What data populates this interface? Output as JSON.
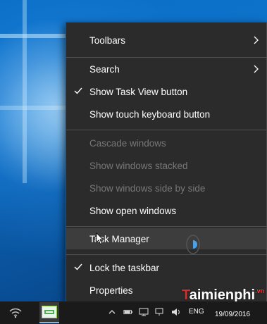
{
  "menu": {
    "items": [
      {
        "label": "Toolbars",
        "checked": false,
        "disabled": false,
        "submenu": true
      },
      {
        "label": "Search",
        "checked": false,
        "disabled": false,
        "submenu": true
      },
      {
        "label": "Show Task View button",
        "checked": true,
        "disabled": false,
        "submenu": false
      },
      {
        "label": "Show touch keyboard button",
        "checked": false,
        "disabled": false,
        "submenu": false
      },
      {
        "label": "Cascade windows",
        "checked": false,
        "disabled": true,
        "submenu": false
      },
      {
        "label": "Show windows stacked",
        "checked": false,
        "disabled": true,
        "submenu": false
      },
      {
        "label": "Show windows side by side",
        "checked": false,
        "disabled": true,
        "submenu": false
      },
      {
        "label": "Show open windows",
        "checked": false,
        "disabled": false,
        "submenu": false
      },
      {
        "label": "Task Manager",
        "checked": false,
        "disabled": false,
        "submenu": false,
        "hovered": true
      },
      {
        "label": "Lock the taskbar",
        "checked": true,
        "disabled": false,
        "submenu": false
      },
      {
        "label": "Properties",
        "checked": false,
        "disabled": false,
        "submenu": false
      }
    ]
  },
  "taskbar": {
    "language": "ENG",
    "date": "19/09/2016",
    "tray_icons": [
      "chevron-up-icon",
      "battery-icon",
      "network-icon",
      "monitor-icon",
      "volume-icon"
    ],
    "pinned_app": "thumbnail-app-icon"
  },
  "watermark": {
    "prefix": "T",
    "brand": "aimienphi",
    "suffix": ".vn"
  },
  "colors": {
    "menu_bg": "#2b2b2b",
    "menu_hover": "#3d3d3d",
    "text": "#ffffff",
    "disabled_text": "#777777",
    "taskbar_bg": "#1a1a1a",
    "accent": "#76b9ed"
  }
}
